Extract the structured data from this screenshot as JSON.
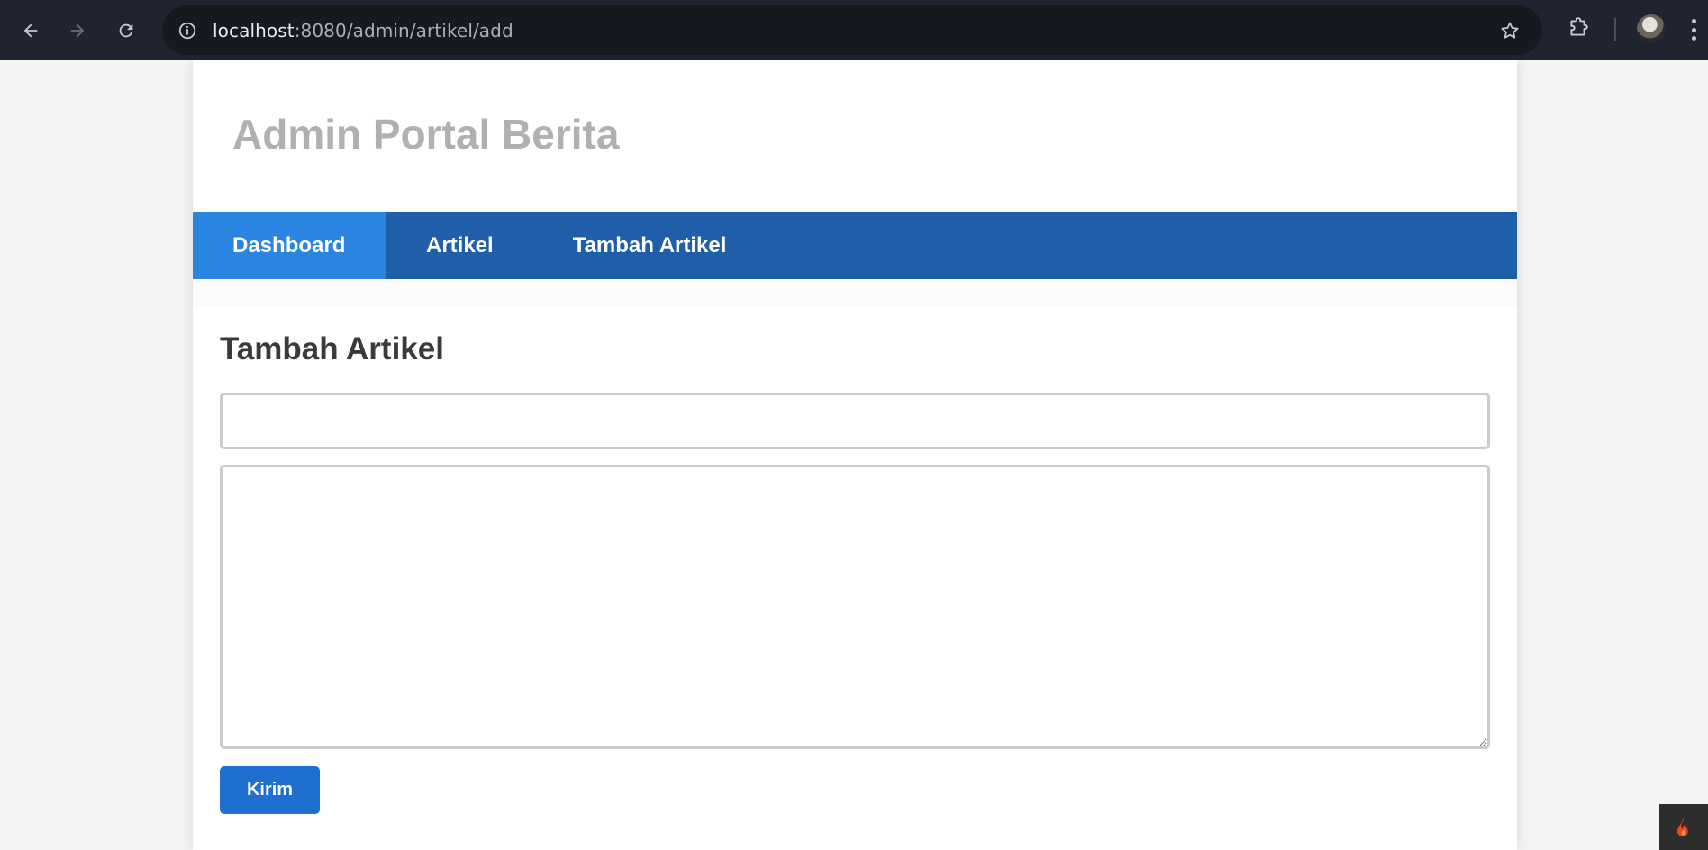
{
  "browser": {
    "url_host": "localhost",
    "url_path": ":8080/admin/artikel/add",
    "back_icon": "arrow-left-icon",
    "forward_icon": "arrow-right-icon",
    "reload_icon": "reload-icon",
    "info_icon": "info-icon",
    "star_icon": "star-icon",
    "extensions_icon": "puzzle-icon",
    "menu_icon": "more-vertical-icon"
  },
  "header": {
    "title": "Admin Portal Berita"
  },
  "nav": {
    "items": [
      {
        "label": "Dashboard",
        "active": true
      },
      {
        "label": "Artikel",
        "active": false
      },
      {
        "label": "Tambah Artikel",
        "active": false
      }
    ]
  },
  "form": {
    "heading": "Tambah Artikel",
    "title_value": "",
    "body_value": "",
    "submit_label": "Kirim"
  },
  "colors": {
    "nav_bg": "#1f5faa",
    "nav_active": "#2a85e0",
    "button": "#1e6fcf",
    "title_text": "#b0b0b0"
  }
}
